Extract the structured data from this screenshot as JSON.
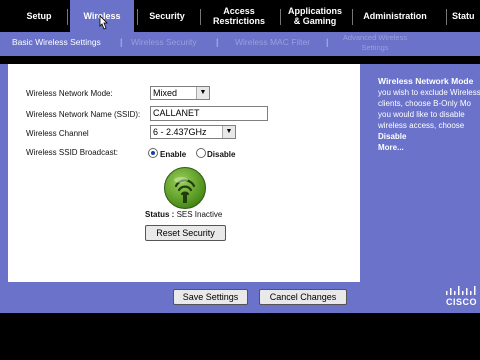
{
  "nav": {
    "tabs": [
      {
        "label": "Setup"
      },
      {
        "label": "Wireless"
      },
      {
        "label": "Security"
      },
      {
        "label": "Access Restrictions",
        "l1": "Access",
        "l2": "Restrictions"
      },
      {
        "label": "Applications & Gaming",
        "l1": "Applications",
        "l2": "& Gaming"
      },
      {
        "label": "Administration"
      },
      {
        "label": "Statu"
      }
    ],
    "active": "Wireless"
  },
  "subnav": {
    "items": [
      {
        "label": "Basic Wireless Settings"
      },
      {
        "label": "Wireless Security"
      },
      {
        "label": "Wireless MAC Filter"
      },
      {
        "label": "Advanced Wireless Settings",
        "l1": "Advanced Wireless",
        "l2": "Settings"
      }
    ],
    "separator": "|"
  },
  "form": {
    "mode_label": "Wireless Network Mode:",
    "mode_value": "Mixed",
    "ssid_label": "Wireless Network Name (SSID):",
    "ssid_value": "CALLANET",
    "channel_label": "Wireless Channel",
    "channel_value": "6 - 2.437GHz",
    "broadcast_label": "Wireless SSID Broadcast:",
    "enable_label": "Enable",
    "disable_label": "Disable",
    "broadcast_selected": "Enable",
    "status_label": "Status :",
    "status_value": "SES Inactive",
    "reset_label": "Reset Security"
  },
  "help": {
    "title": "Wireless Network Mode",
    "lines": [
      "you wish to exclude Wireless",
      "clients, choose B-Only Mo",
      "you would like to disable",
      "wireless access, choose"
    ],
    "bold1": "Disable",
    "more": "More..."
  },
  "actions": {
    "save": "Save Settings",
    "cancel": "Cancel Changes"
  },
  "brand": {
    "logo_text": "CISCO"
  },
  "colors": {
    "accent": "#6a72c9",
    "ses_green": "#4b8d1a"
  }
}
